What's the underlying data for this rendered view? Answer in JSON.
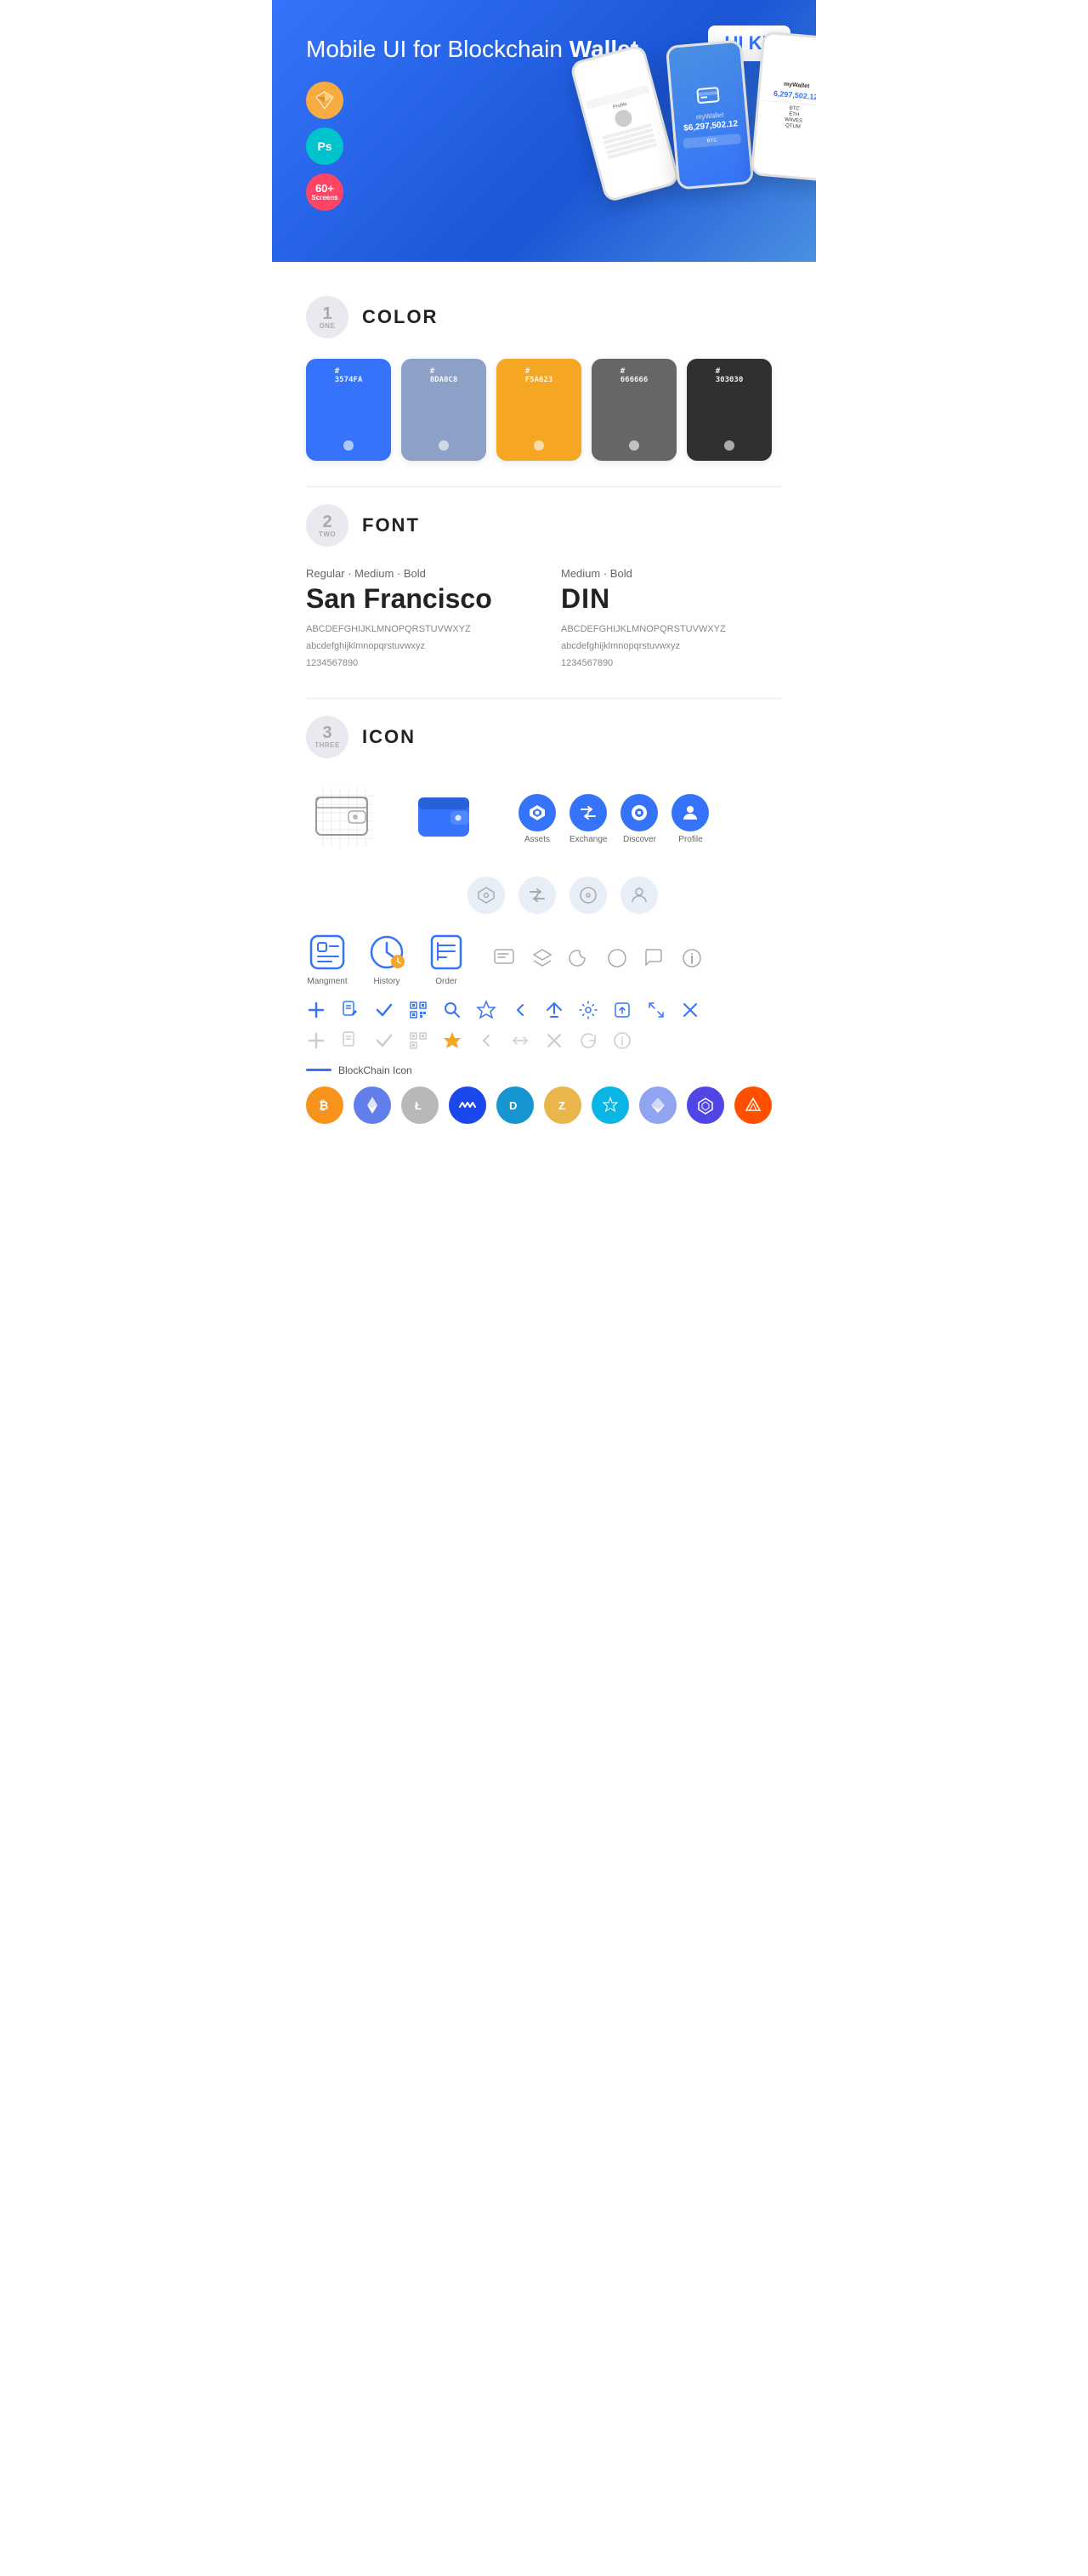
{
  "hero": {
    "title": "Mobile UI for Blockchain ",
    "title_bold": "Wallet",
    "badge": "UI Kit",
    "sketch_label": "Sk",
    "ps_label": "Ps",
    "screens_label": "60+\nScreens"
  },
  "sections": {
    "color": {
      "number": "1",
      "word": "ONE",
      "title": "COLOR",
      "swatches": [
        {
          "hex": "#3574FA",
          "label": "3574FA",
          "light": false
        },
        {
          "hex": "#8DA0C8",
          "label": "8DA0C8",
          "light": false
        },
        {
          "hex": "#F5A623",
          "label": "F5A623",
          "light": false
        },
        {
          "hex": "#666666",
          "label": "666666",
          "light": false
        },
        {
          "hex": "#303030",
          "label": "303030",
          "light": false
        }
      ]
    },
    "font": {
      "number": "2",
      "word": "TWO",
      "title": "FONT",
      "fonts": [
        {
          "style": "Regular · Medium · Bold",
          "name": "San Francisco",
          "upper": "ABCDEFGHIJKLMNOPQRSTUVWXYZ",
          "lower": "abcdefghijklmnopqrstuvwxyz",
          "nums": "1234567890"
        },
        {
          "style": "Medium · Bold",
          "name": "DIN",
          "upper": "ABCDEFGHIJKLMNOPQRSTUVWXYZ",
          "lower": "abcdefghijklmnopqrstuvwxyz",
          "nums": "1234567890"
        }
      ]
    },
    "icon": {
      "number": "3",
      "word": "THREE",
      "title": "ICON",
      "nav_icons": [
        {
          "label": "Assets"
        },
        {
          "label": "Exchange"
        },
        {
          "label": "Discover"
        },
        {
          "label": "Profile"
        }
      ],
      "management_icons": [
        {
          "label": "Mangment"
        },
        {
          "label": "History"
        },
        {
          "label": "Order"
        }
      ],
      "blockchain_label": "BlockChain Icon",
      "crypto_coins": [
        "BTC",
        "ETH",
        "LTC",
        "WAVES",
        "DASH",
        "ZEC",
        "XLM",
        "ETH2",
        "POLY",
        "BAT"
      ]
    }
  }
}
